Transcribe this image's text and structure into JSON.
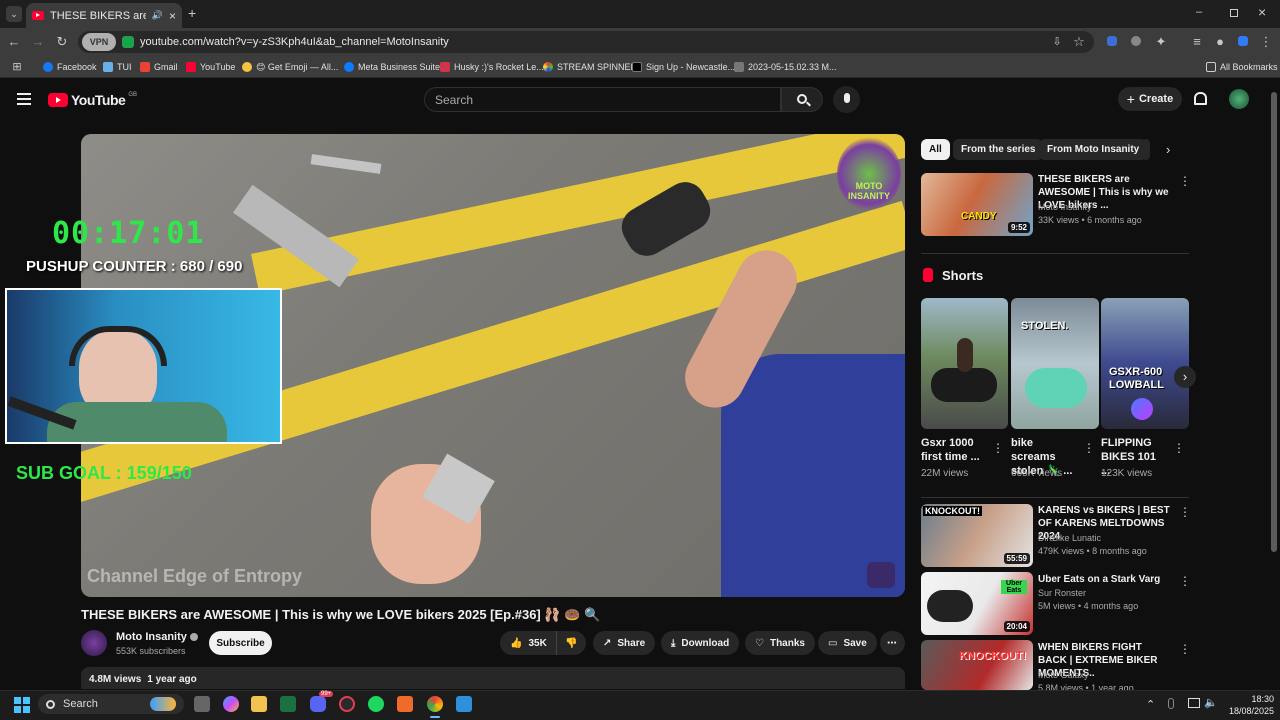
{
  "browser": {
    "tab_title": "THESE BIKERS are AWESOME",
    "url": "youtube.com/watch?v=y-zS3Kph4uI&ab_channel=MotoInsanity",
    "vpn_label": "VPN",
    "bookmarks": [
      "Facebook",
      "TUI",
      "Gmail",
      "YouTube",
      "😊 Get Emoji — All...",
      "Meta Business Suite",
      "Husky :)'s Rocket Le...",
      "STREAM SPINNER",
      "Sign Up - Newcastle...",
      "2023-05-15.02.33 M..."
    ],
    "all_bookmarks": "All Bookmarks"
  },
  "header": {
    "logo_text": "YouTube",
    "region": "GB",
    "search_placeholder": "Search",
    "create_label": "Create"
  },
  "video": {
    "timer": "00:17:01",
    "pushup_counter": "PUSHUP COUNTER : 680 / 690",
    "sub_goal": "SUB GOAL : 159/150",
    "watermark": "Channel Edge of Entropy",
    "logo_text": "MOTO INSANITY",
    "title": "THESE BIKERS are AWESOME | This is why we LOVE bikers 2025 [Ep.#36] 🩰 🍩 🔍",
    "channel": "Moto Insanity",
    "subscribers": "553K subscribers",
    "subscribe_label": "Subscribe",
    "likes": "35K",
    "share_label": "Share",
    "download_label": "Download",
    "thanks_label": "Thanks",
    "save_label": "Save",
    "views": "4.8M views",
    "age": "1 year ago"
  },
  "sidebar": {
    "chips": [
      "All",
      "From the series",
      "From Moto Insanity"
    ],
    "top_video": {
      "title": "THESE BIKERS are AWESOME | This is why we LOVE bikers ...",
      "channel": "Moto Insanity",
      "meta": "33K views • 6 months ago",
      "duration": "9:52",
      "thumb_text": "CANDY"
    },
    "shorts_heading": "Shorts",
    "shorts": [
      {
        "title": "Gsxr 1000 first time ...",
        "views": "22M views",
        "thumb_text": ""
      },
      {
        "title": "bike screams stolen 🦎 ...",
        "views": "665K views",
        "thumb_text": "STOLEN."
      },
      {
        "title": "FLIPPING BIKES 101 ...",
        "views": "123K views",
        "thumb_text": "GSXR-600 LOWBALL"
      }
    ],
    "videos": [
      {
        "title": "KARENS vs BIKERS | BEST OF KARENS MELTDOWNS 2024",
        "channel": "DirtBike Lunatic",
        "meta": "479K views • 8 months ago",
        "duration": "55:59",
        "thumb_text": "KNOCKOUT!"
      },
      {
        "title": "Uber Eats on a Stark Varg",
        "channel": "Sur Ronster",
        "meta": "5M views • 4 months ago",
        "duration": "20:04",
        "thumb_text": "Uber Eats"
      },
      {
        "title": "WHEN BIKERS FIGHT BACK | EXTREME BIKER MOMENTS..",
        "channel": "Moto Galaxy",
        "meta": "5.8M views • 1 year ago",
        "duration": "",
        "thumb_text": "KNOCKOUT!"
      }
    ]
  },
  "taskbar": {
    "search_label": "Search",
    "time": "18:30",
    "date": "18/08/2025",
    "badge": "99+"
  }
}
